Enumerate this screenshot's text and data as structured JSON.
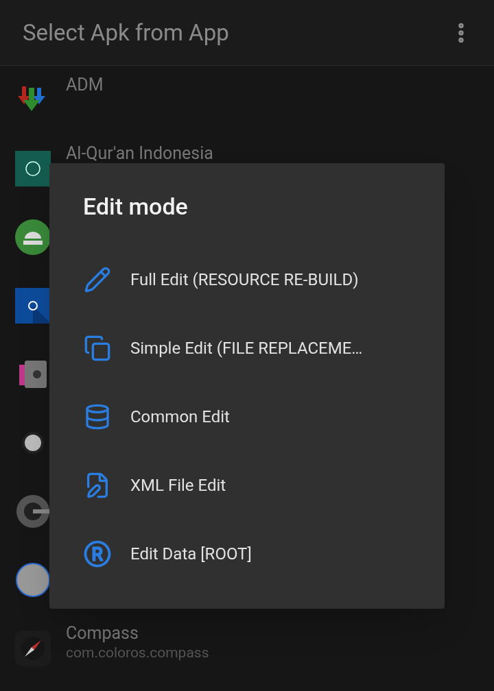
{
  "app_bar": {
    "title": "Select Apk from App"
  },
  "apps": [
    {
      "kind": "adm",
      "name": "ADM"
    },
    {
      "kind": "quran",
      "name": "Al-Qur'an Indonesia"
    },
    {
      "kind": "android"
    },
    {
      "kind": "blue-square"
    },
    {
      "kind": "safe"
    },
    {
      "kind": "dot"
    },
    {
      "kind": "g-ring"
    },
    {
      "kind": "checker"
    },
    {
      "kind": "compass",
      "name": "Compass",
      "package": "com.coloros.compass"
    }
  ],
  "dialog": {
    "title": "Edit mode",
    "options": [
      {
        "kind": "pencil",
        "label": "Full Edit (RESOURCE RE-BUILD)"
      },
      {
        "kind": "copy",
        "label": "Simple Edit (FILE REPLACEME…"
      },
      {
        "kind": "database",
        "label": "Common Edit"
      },
      {
        "kind": "file",
        "label": "XML File Edit"
      },
      {
        "kind": "registered",
        "label": "Edit Data [ROOT]"
      }
    ]
  }
}
